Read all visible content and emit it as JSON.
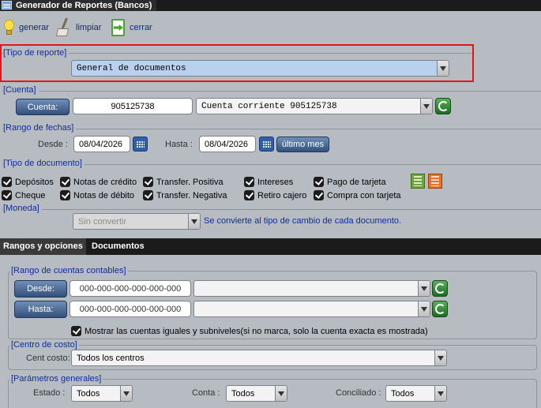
{
  "window": {
    "title": "Generador de Reportes (Bancos)",
    "icon": "report-window-icon"
  },
  "toolbar": {
    "generar": {
      "label": "generar",
      "icon": "lightbulb-icon"
    },
    "limpiar": {
      "label": "limpiar",
      "icon": "broom-icon"
    },
    "cerrar": {
      "label": "cerrar",
      "icon": "exit-document-icon"
    }
  },
  "tipo_reporte": {
    "title": "[Tipo de reporte]",
    "selected": "General de documentos"
  },
  "cuenta": {
    "title": "[Cuenta]",
    "button_label": "Cuenta:",
    "number": "905125738",
    "selected": "Cuenta corriente 905125738"
  },
  "rango_fechas": {
    "title": "[Rango de fechas]",
    "desde_label": "Desde :",
    "desde_value": "08/04/2026",
    "hasta_label": "Hasta :",
    "hasta_value": "08/04/2026",
    "ultimo_mes_label": "último mes"
  },
  "tipo_documento": {
    "title": "[Tipo de documento]",
    "items": [
      {
        "label": "Depósitos",
        "checked": true
      },
      {
        "label": "Notas de crédito",
        "checked": true
      },
      {
        "label": "Transfer. Positiva",
        "checked": true
      },
      {
        "label": "Intereses",
        "checked": true
      },
      {
        "label": "Pago de tarjeta",
        "checked": true
      },
      {
        "label": "Cheque",
        "checked": true
      },
      {
        "label": "Notas de débito",
        "checked": true
      },
      {
        "label": "Transfer. Negativa",
        "checked": true
      },
      {
        "label": "Retiro cajero",
        "checked": true
      },
      {
        "label": "Compra con tarjeta",
        "checked": true
      }
    ],
    "export_icons": [
      "excel-export-icon",
      "pdf-export-icon"
    ]
  },
  "moneda": {
    "title": "[Moneda]",
    "selected": "Sin convertir",
    "note": "Se convierte al tipo de cambio de cada documento."
  },
  "tabs": [
    {
      "label": "Rangos y opciones",
      "active": true
    },
    {
      "label": "Documentos",
      "active": false
    }
  ],
  "rango_cuentas": {
    "title": "[Rango de cuentas contables]",
    "desde_label": "Desde:",
    "desde_placeholder": "000-000-000-000-000-000",
    "hasta_label": "Hasta:",
    "hasta_placeholder": "000-000-000-000-000-000",
    "mostrar_label": "Mostrar las cuentas iguales y subniveles(si no marca, solo la cuenta exacta es mostrada)"
  },
  "centro_costo": {
    "title": "[Centro de costo]",
    "label": "Cent costo:",
    "selected": "Todos los centros"
  },
  "parametros": {
    "title": "[Parámetros generales]",
    "estado_label": "Estado :",
    "estado_value": "Todos",
    "conta_label": "Conta :",
    "conta_value": "Todos",
    "conciliado_label": "Conciliado :",
    "conciliado_value": "Todos"
  },
  "colors": {
    "background": "#b7bcc3",
    "section_title": "#0f2d99",
    "highlight_border": "#e8121b",
    "dark_button": "#33507b",
    "refresh_button": "#2a7f2e"
  }
}
